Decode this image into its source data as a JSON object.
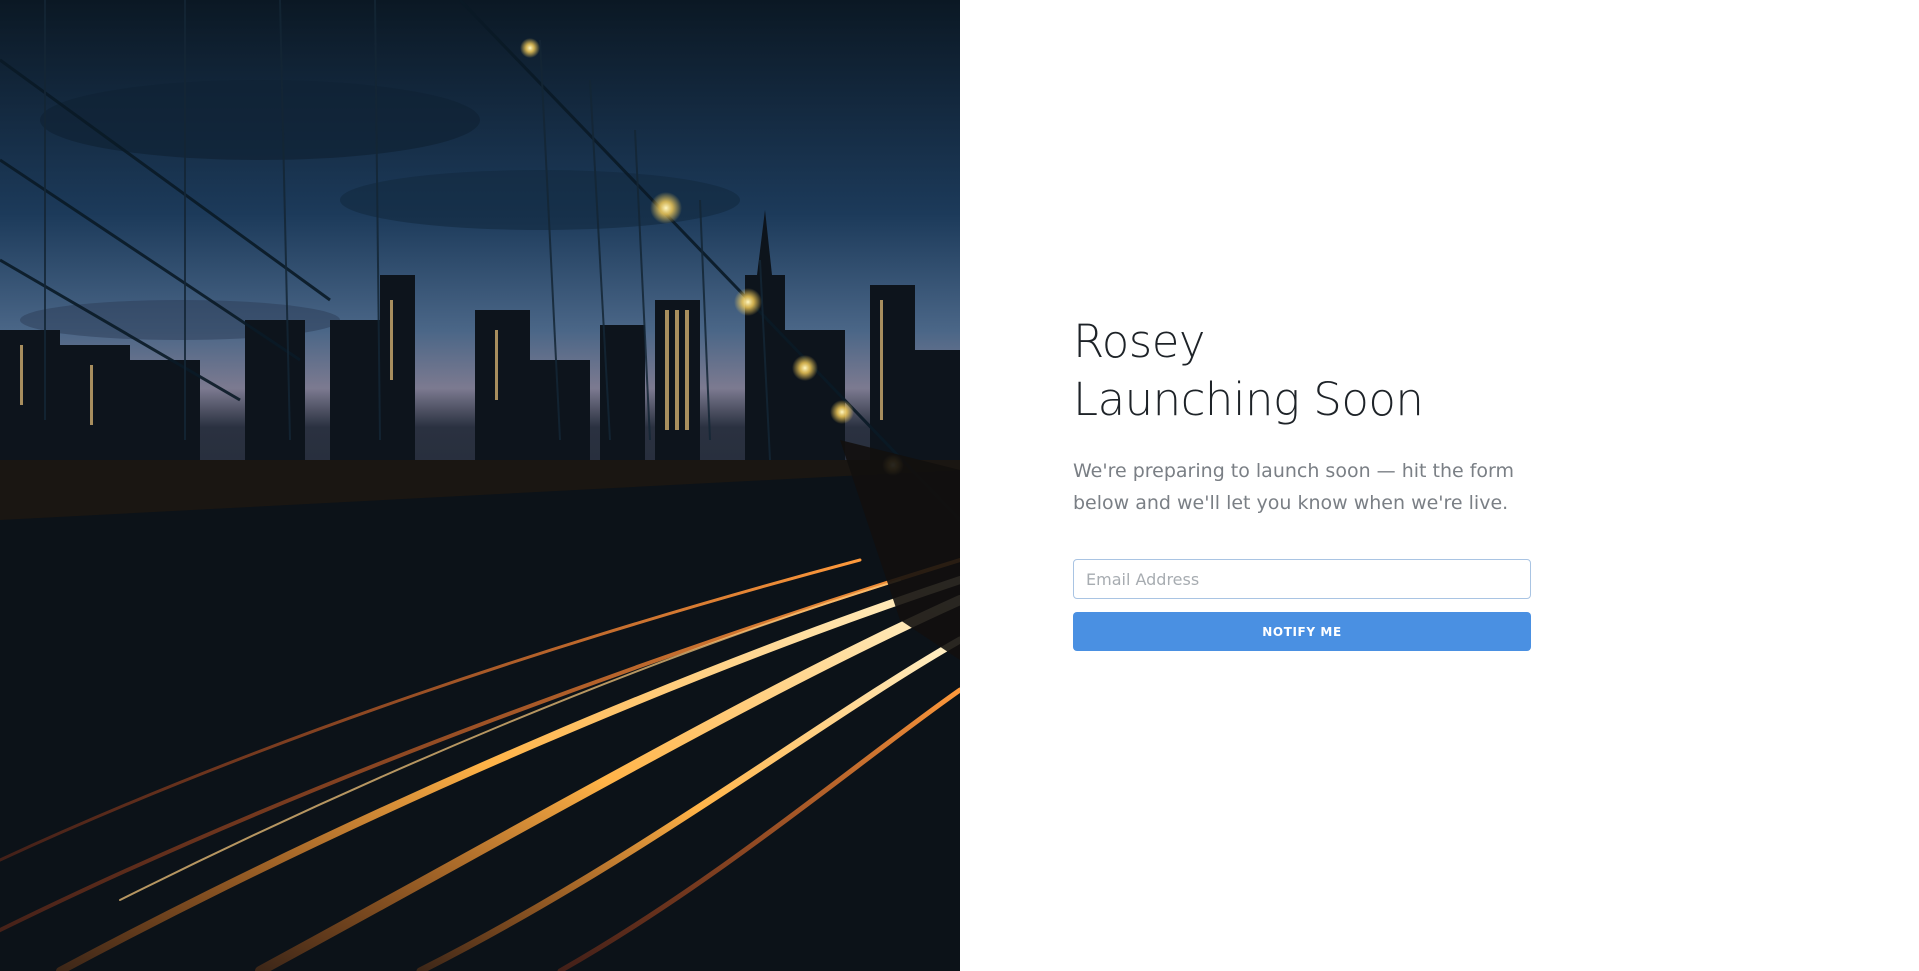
{
  "hero": {
    "image_description_name": "city-bridge-night-photo"
  },
  "main": {
    "title_line1": "Rosey",
    "title_line2": "Launching Soon",
    "lead": "We're preparing to launch soon — hit the form below and we'll let you know when we're live."
  },
  "form": {
    "email_placeholder": "Email Address",
    "email_value": "",
    "submit_label": "NOTIFY ME"
  },
  "colors": {
    "accent": "#4a90e2",
    "title": "#1e2328",
    "lead": "#7a7f85",
    "input_border": "#a9c4e3"
  }
}
